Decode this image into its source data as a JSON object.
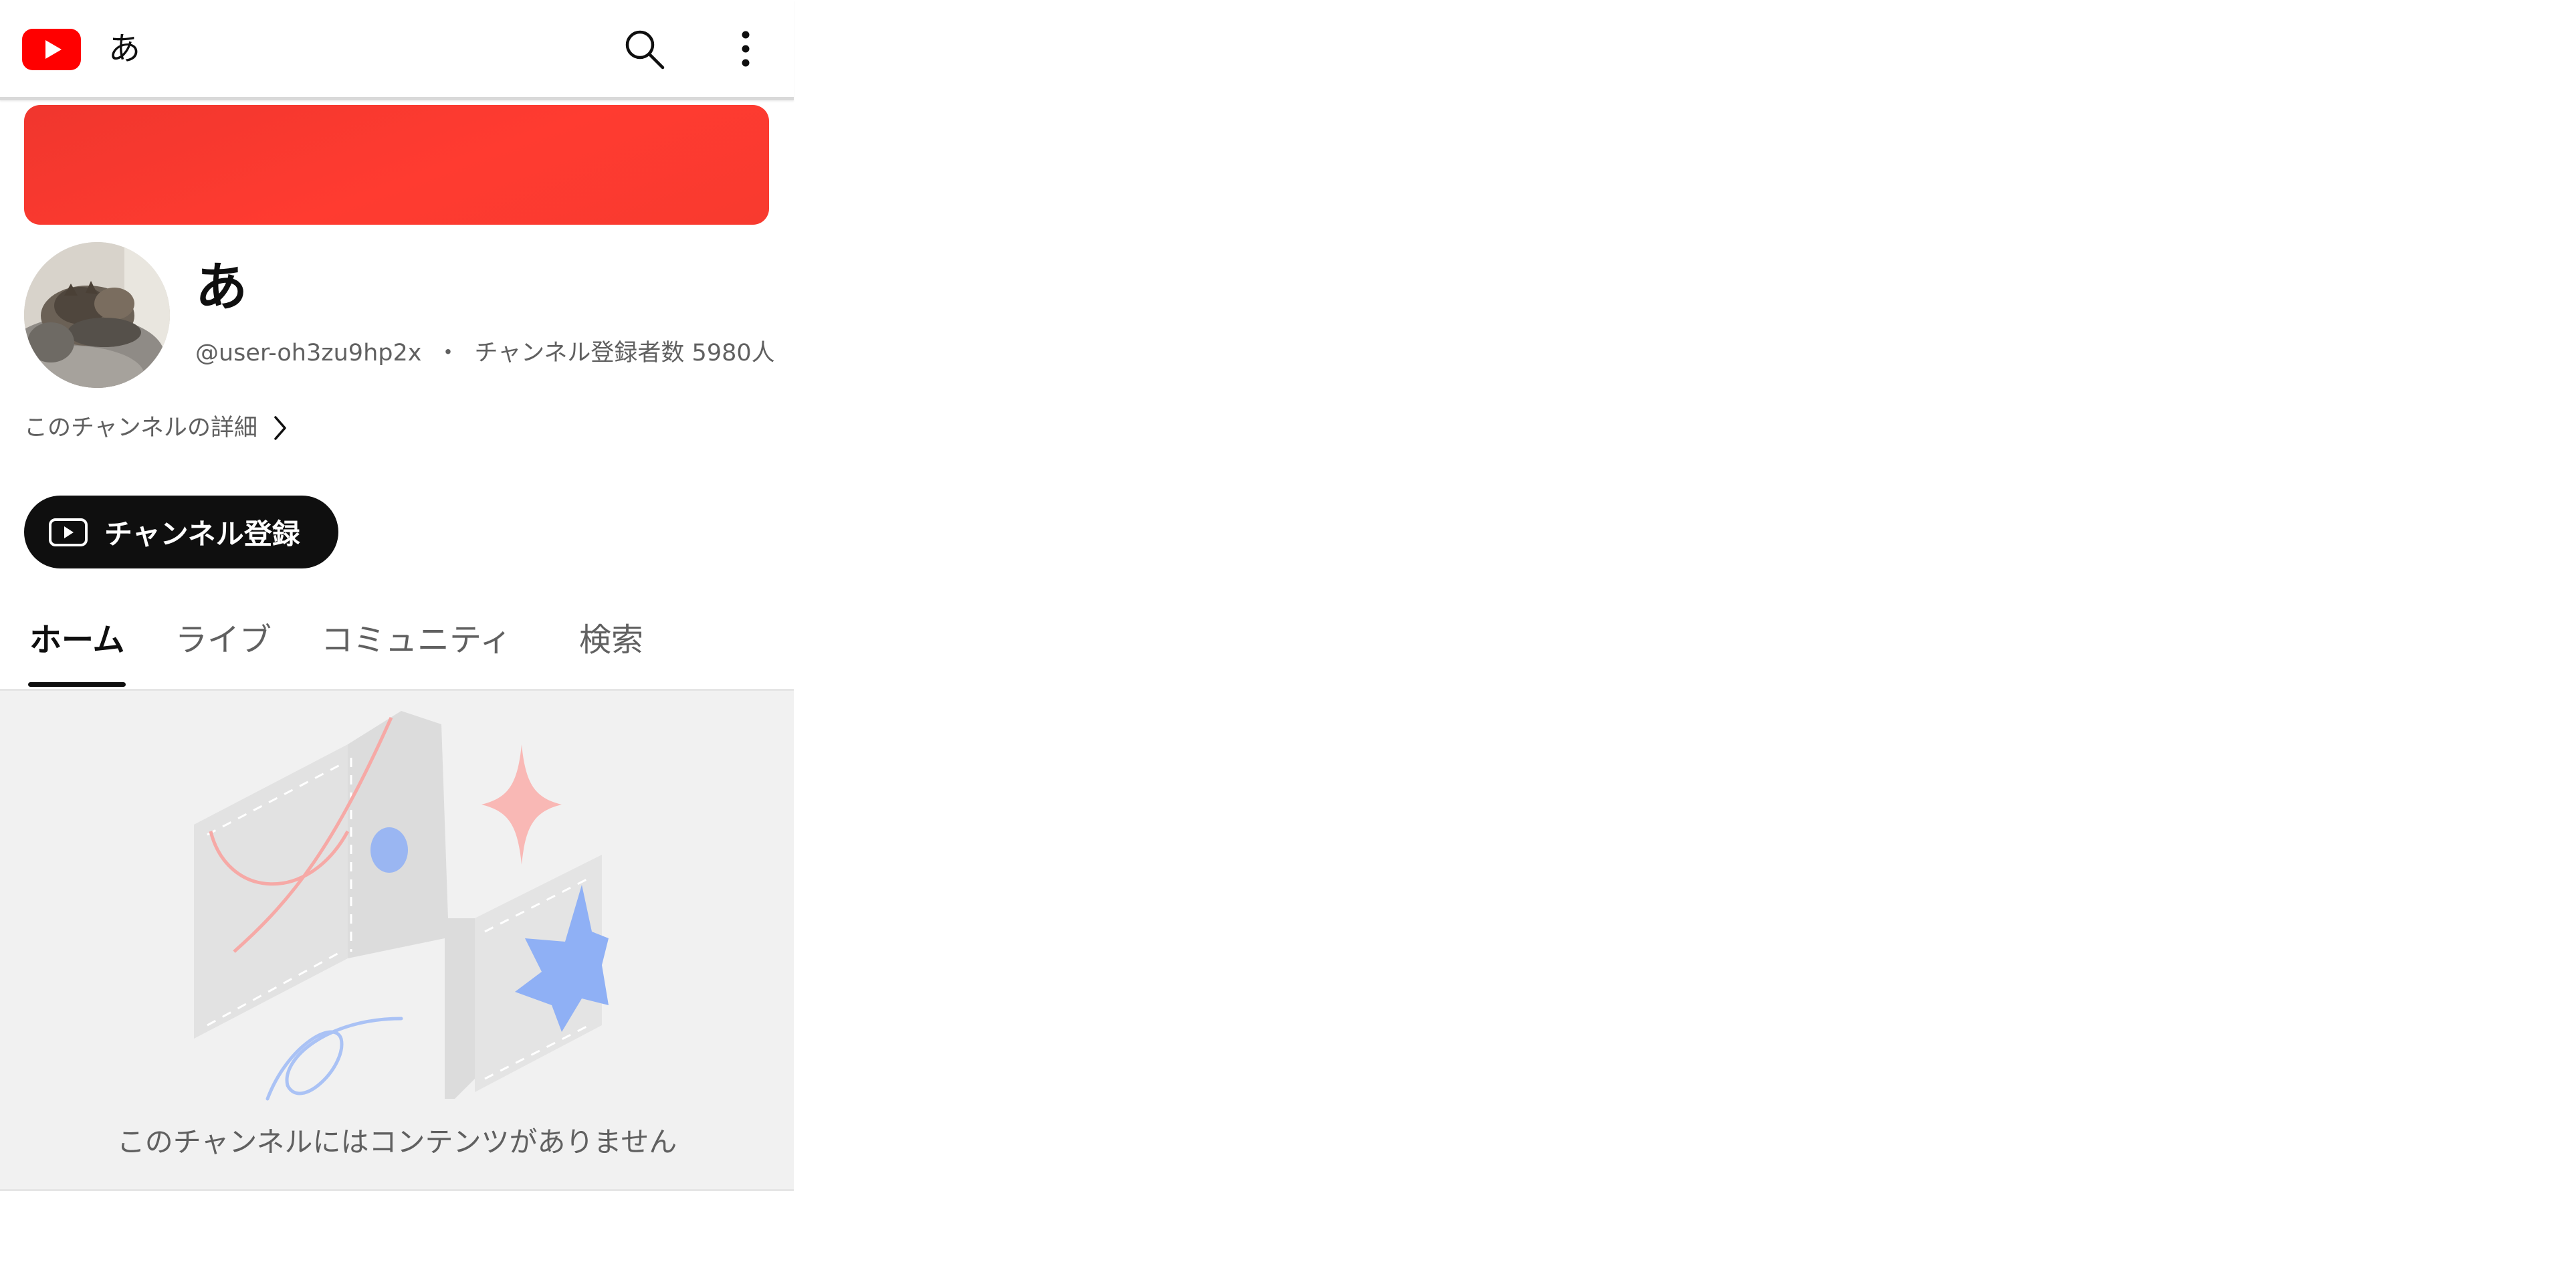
{
  "topbar": {
    "logo_icon": "youtube-logo-icon",
    "title": "あ",
    "search_icon": "search-icon",
    "more_icon": "more-vert-icon"
  },
  "channel": {
    "name": "あ",
    "handle": "@user-oh3zu9hp2x",
    "separator": "・",
    "subscribers": "チャンネル登録者数 5980人",
    "details_link": "このチャンネルの詳細",
    "subscribe_label": "チャンネル登録"
  },
  "tabs": [
    {
      "label": "ホーム",
      "active": true
    },
    {
      "label": "ライブ",
      "active": false
    },
    {
      "label": "コミュニティ",
      "active": false
    },
    {
      "label": "検索",
      "active": false
    }
  ],
  "empty_state": {
    "message": "このチャンネルにはコンテンツがありません"
  },
  "colors": {
    "brand_red": "#ff0000",
    "banner_red": "#ff3b30",
    "subscribe_bg": "#0f0f0f",
    "empty_bg": "#f1f1f1"
  }
}
